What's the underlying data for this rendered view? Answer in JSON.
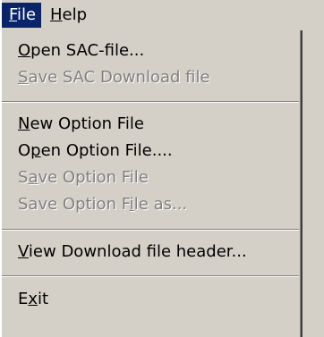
{
  "menubar": {
    "file": {
      "pre": "",
      "accel": "F",
      "post": "ile"
    },
    "help": {
      "pre": "",
      "accel": "H",
      "post": "elp"
    }
  },
  "menu": {
    "open_sac": {
      "pre": "",
      "accel": "O",
      "post": "pen SAC-file..."
    },
    "save_sac": {
      "pre": "",
      "accel": "S",
      "post": "ave SAC Download file"
    },
    "new_option": {
      "pre": "",
      "accel": "N",
      "post": "ew Option File"
    },
    "open_option": {
      "pre": "O",
      "accel": "p",
      "post": "en Option File...."
    },
    "save_option": {
      "pre": "S",
      "accel": "a",
      "post": "ve Option File"
    },
    "save_option_as": {
      "pre": "Save Option F",
      "accel": "i",
      "post": "le as..."
    },
    "view_header": {
      "pre": "",
      "accel": "V",
      "post": "iew Download file header..."
    },
    "exit": {
      "pre": "E",
      "accel": "x",
      "post": "it"
    }
  },
  "colors": {
    "menu_bg": "#d4d0c8",
    "highlight": "#0a246a",
    "disabled_text": "#808080"
  }
}
